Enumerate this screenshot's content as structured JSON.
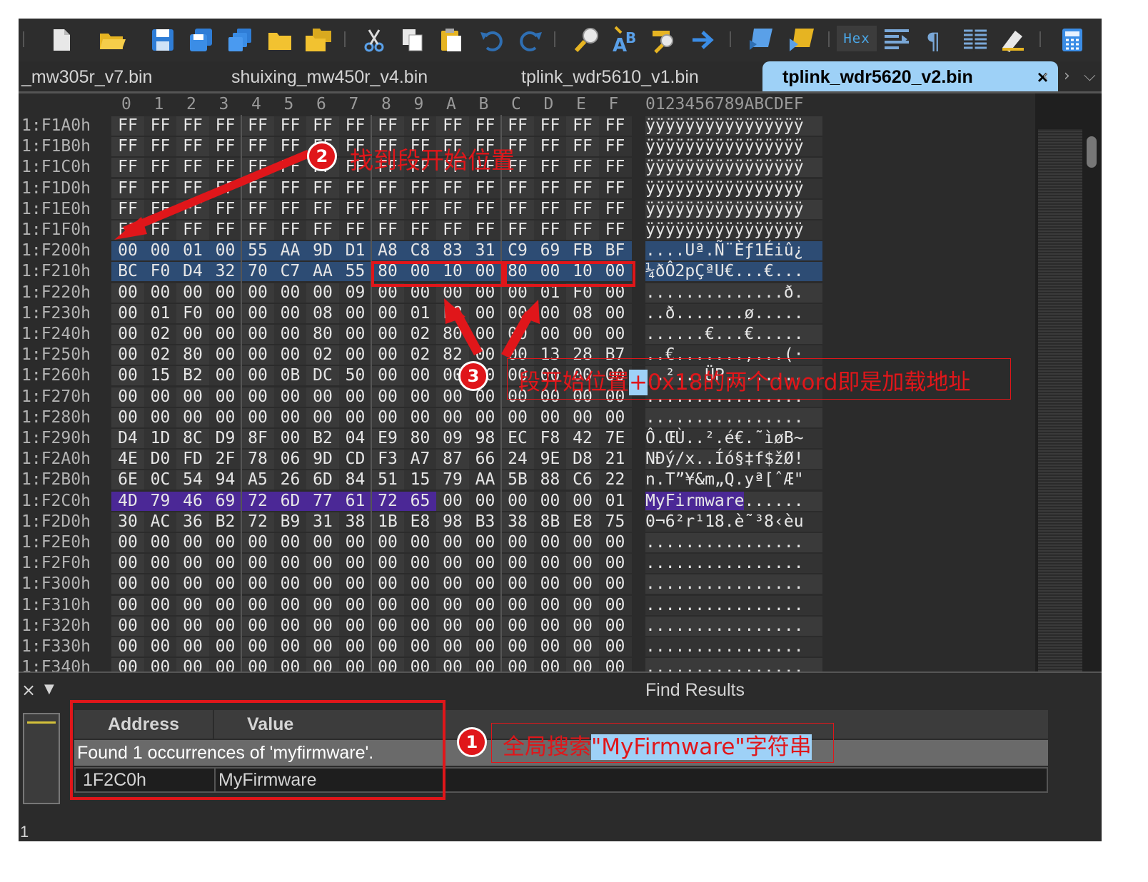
{
  "toolbar": {
    "icons": [
      "new-file-icon",
      "open-folder-icon",
      "save-icon",
      "save-as-icon",
      "save-all-icon",
      "folder-icon",
      "folders-icon",
      "cut-icon",
      "copy-icon",
      "paste-icon",
      "undo-icon",
      "redo-icon",
      "find-icon",
      "replace-icon",
      "find-in-files-icon",
      "goto-icon",
      "macro-icon",
      "macro-play-icon",
      "hex-mode-icon",
      "column-icon",
      "paragraph-icon",
      "list-icon",
      "highlight-icon",
      "calculator-icon"
    ],
    "hex_label": "Hex"
  },
  "tabs": [
    {
      "label": "_mw305r_v7.bin",
      "active": false
    },
    {
      "label": "shuixing_mw450r_v4.bin",
      "active": false
    },
    {
      "label": "tplink_wdr5610_v1.bin",
      "active": false
    },
    {
      "label": "tplink_wdr5620_v2.bin",
      "active": true
    }
  ],
  "tab_close": "×",
  "tab_nav": {
    "prev": "‹",
    "next": "›",
    "menu": "⌵"
  },
  "hex_header": {
    "columns": [
      "0",
      "1",
      "2",
      "3",
      "4",
      "5",
      "6",
      "7",
      "8",
      "9",
      "A",
      "B",
      "C",
      "D",
      "E",
      "F"
    ],
    "ascii_header": "0123456789ABCDEF"
  },
  "rows": [
    {
      "addr": "1:F1A0h",
      "bytes": [
        "FF",
        "FF",
        "FF",
        "FF",
        "FF",
        "FF",
        "FF",
        "FF",
        "FF",
        "FF",
        "FF",
        "FF",
        "FF",
        "FF",
        "FF",
        "FF"
      ],
      "ascii": "ÿÿÿÿÿÿÿÿÿÿÿÿÿÿÿÿ"
    },
    {
      "addr": "1:F1B0h",
      "bytes": [
        "FF",
        "FF",
        "FF",
        "FF",
        "FF",
        "FF",
        "FF",
        "FF",
        "FF",
        "FF",
        "FF",
        "FF",
        "FF",
        "FF",
        "FF",
        "FF"
      ],
      "ascii": "ÿÿÿÿÿÿÿÿÿÿÿÿÿÿÿÿ"
    },
    {
      "addr": "1:F1C0h",
      "bytes": [
        "FF",
        "FF",
        "FF",
        "FF",
        "FF",
        "FF",
        "FF",
        "FF",
        "FF",
        "FF",
        "FF",
        "FF",
        "FF",
        "FF",
        "FF",
        "FF"
      ],
      "ascii": "ÿÿÿÿÿÿÿÿÿÿÿÿÿÿÿÿ"
    },
    {
      "addr": "1:F1D0h",
      "bytes": [
        "FF",
        "FF",
        "FF",
        "FF",
        "FF",
        "FF",
        "FF",
        "FF",
        "FF",
        "FF",
        "FF",
        "FF",
        "FF",
        "FF",
        "FF",
        "FF"
      ],
      "ascii": "ÿÿÿÿÿÿÿÿÿÿÿÿÿÿÿÿ"
    },
    {
      "addr": "1:F1E0h",
      "bytes": [
        "FF",
        "FF",
        "FF",
        "FF",
        "FF",
        "FF",
        "FF",
        "FF",
        "FF",
        "FF",
        "FF",
        "FF",
        "FF",
        "FF",
        "FF",
        "FF"
      ],
      "ascii": "ÿÿÿÿÿÿÿÿÿÿÿÿÿÿÿÿ"
    },
    {
      "addr": "1:F1F0h",
      "bytes": [
        "FF",
        "FF",
        "FF",
        "FF",
        "FF",
        "FF",
        "FF",
        "FF",
        "FF",
        "FF",
        "FF",
        "FF",
        "FF",
        "FF",
        "FF",
        "FF"
      ],
      "ascii": "ÿÿÿÿÿÿÿÿÿÿÿÿÿÿÿÿ"
    },
    {
      "addr": "1:F200h",
      "bytes": [
        "00",
        "00",
        "01",
        "00",
        "55",
        "AA",
        "9D",
        "D1",
        "A8",
        "C8",
        "83",
        "31",
        "C9",
        "69",
        "FB",
        "BF"
      ],
      "ascii": "....Uª.Ñ¨Èƒ1Éiû¿",
      "hl": "sel"
    },
    {
      "addr": "1:F210h",
      "bytes": [
        "BC",
        "F0",
        "D4",
        "32",
        "70",
        "C7",
        "AA",
        "55",
        "80",
        "00",
        "10",
        "00",
        "80",
        "00",
        "10",
        "00"
      ],
      "ascii": "¼ðÔ2pÇªU€...€...",
      "hl": "sel"
    },
    {
      "addr": "1:F220h",
      "bytes": [
        "00",
        "00",
        "00",
        "00",
        "00",
        "00",
        "00",
        "09",
        "00",
        "00",
        "00",
        "00",
        "00",
        "01",
        "F0",
        "00"
      ],
      "ascii": "..............ð."
    },
    {
      "addr": "1:F230h",
      "bytes": [
        "00",
        "01",
        "F0",
        "00",
        "00",
        "00",
        "08",
        "00",
        "00",
        "01",
        "F8",
        "00",
        "00",
        "00",
        "08",
        "00"
      ],
      "ascii": "..ð.......ø....."
    },
    {
      "addr": "1:F240h",
      "bytes": [
        "00",
        "02",
        "00",
        "00",
        "00",
        "00",
        "80",
        "00",
        "00",
        "02",
        "80",
        "00",
        "00",
        "00",
        "00",
        "00"
      ],
      "ascii": "......€...€....."
    },
    {
      "addr": "1:F250h",
      "bytes": [
        "00",
        "02",
        "80",
        "00",
        "00",
        "00",
        "02",
        "00",
        "00",
        "02",
        "82",
        "00",
        "00",
        "13",
        "28",
        "B7"
      ],
      "ascii": "..€.......‚...(·"
    },
    {
      "addr": "1:F260h",
      "bytes": [
        "00",
        "15",
        "B2",
        "00",
        "00",
        "0B",
        "DC",
        "50",
        "00",
        "00",
        "00",
        "00",
        "00",
        "00",
        "00",
        "00"
      ],
      "ascii": "..²...ÜP........"
    },
    {
      "addr": "1:F270h",
      "bytes": [
        "00",
        "00",
        "00",
        "00",
        "00",
        "00",
        "00",
        "00",
        "00",
        "00",
        "00",
        "00",
        "00",
        "00",
        "00",
        "00"
      ],
      "ascii": "................"
    },
    {
      "addr": "1:F280h",
      "bytes": [
        "00",
        "00",
        "00",
        "00",
        "00",
        "00",
        "00",
        "00",
        "00",
        "00",
        "00",
        "00",
        "00",
        "00",
        "00",
        "00"
      ],
      "ascii": "................"
    },
    {
      "addr": "1:F290h",
      "bytes": [
        "D4",
        "1D",
        "8C",
        "D9",
        "8F",
        "00",
        "B2",
        "04",
        "E9",
        "80",
        "09",
        "98",
        "EC",
        "F8",
        "42",
        "7E"
      ],
      "ascii": "Ô.ŒÙ..².é€.˜ìøB~"
    },
    {
      "addr": "1:F2A0h",
      "bytes": [
        "4E",
        "D0",
        "FD",
        "2F",
        "78",
        "06",
        "9D",
        "CD",
        "F3",
        "A7",
        "87",
        "66",
        "24",
        "9E",
        "D8",
        "21"
      ],
      "ascii": "NÐý/x..Íó§‡f$žØ!"
    },
    {
      "addr": "1:F2B0h",
      "bytes": [
        "6E",
        "0C",
        "54",
        "94",
        "A5",
        "26",
        "6D",
        "84",
        "51",
        "15",
        "79",
        "AA",
        "5B",
        "88",
        "C6",
        "22"
      ],
      "ascii": "n.T”¥&m„Q.yª[ˆÆ\""
    },
    {
      "addr": "1:F2C0h",
      "bytes": [
        "4D",
        "79",
        "46",
        "69",
        "72",
        "6D",
        "77",
        "61",
        "72",
        "65",
        "00",
        "00",
        "00",
        "00",
        "00",
        "01"
      ],
      "ascii": "MyFirmware......",
      "hl": "pur"
    },
    {
      "addr": "1:F2D0h",
      "bytes": [
        "30",
        "AC",
        "36",
        "B2",
        "72",
        "B9",
        "31",
        "38",
        "1B",
        "E8",
        "98",
        "B3",
        "38",
        "8B",
        "E8",
        "75"
      ],
      "ascii": "0¬6²r¹18.è˜³8‹èu"
    },
    {
      "addr": "1:F2E0h",
      "bytes": [
        "00",
        "00",
        "00",
        "00",
        "00",
        "00",
        "00",
        "00",
        "00",
        "00",
        "00",
        "00",
        "00",
        "00",
        "00",
        "00"
      ],
      "ascii": "................"
    },
    {
      "addr": "1:F2F0h",
      "bytes": [
        "00",
        "00",
        "00",
        "00",
        "00",
        "00",
        "00",
        "00",
        "00",
        "00",
        "00",
        "00",
        "00",
        "00",
        "00",
        "00"
      ],
      "ascii": "................"
    },
    {
      "addr": "1:F300h",
      "bytes": [
        "00",
        "00",
        "00",
        "00",
        "00",
        "00",
        "00",
        "00",
        "00",
        "00",
        "00",
        "00",
        "00",
        "00",
        "00",
        "00"
      ],
      "ascii": "................"
    },
    {
      "addr": "1:F310h",
      "bytes": [
        "00",
        "00",
        "00",
        "00",
        "00",
        "00",
        "00",
        "00",
        "00",
        "00",
        "00",
        "00",
        "00",
        "00",
        "00",
        "00"
      ],
      "ascii": "................"
    },
    {
      "addr": "1:F320h",
      "bytes": [
        "00",
        "00",
        "00",
        "00",
        "00",
        "00",
        "00",
        "00",
        "00",
        "00",
        "00",
        "00",
        "00",
        "00",
        "00",
        "00"
      ],
      "ascii": "................"
    },
    {
      "addr": "1:F330h",
      "bytes": [
        "00",
        "00",
        "00",
        "00",
        "00",
        "00",
        "00",
        "00",
        "00",
        "00",
        "00",
        "00",
        "00",
        "00",
        "00",
        "00"
      ],
      "ascii": "................"
    },
    {
      "addr": "1:F340h",
      "bytes": [
        "00",
        "00",
        "00",
        "00",
        "00",
        "00",
        "00",
        "00",
        "00",
        "00",
        "00",
        "00",
        "00",
        "00",
        "00",
        "00"
      ],
      "ascii": "................"
    }
  ],
  "annotations": {
    "step1": {
      "num": "1",
      "prefix": "全局搜索",
      "highlight": "\"MyFirmware\"",
      "suffix": "字符串"
    },
    "step2": {
      "num": "2",
      "text": "找到段开始位置"
    },
    "step3": {
      "num": "3",
      "prefix": "段开始位置",
      "highlight": "+",
      "suffix": "0x18的两个dword即是加载地址"
    }
  },
  "find_results": {
    "title": "Find Results",
    "close": "×",
    "columns": [
      "Address",
      "Value"
    ],
    "summary": "Found 1 occurrences of 'myfirmware'.",
    "results": [
      {
        "address": "1F2C0h",
        "value": "MyFirmware"
      }
    ],
    "count": "1"
  },
  "colors": {
    "annotation_red": "#e0161a",
    "highlight_blue": "#9ed1f7",
    "selection": "#2d4c74",
    "match_purple": "#4b2896"
  }
}
